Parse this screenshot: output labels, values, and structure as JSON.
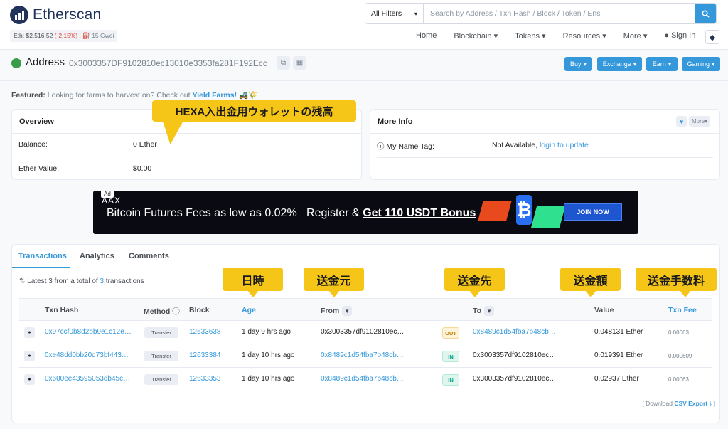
{
  "header": {
    "logo_text": "Etherscan",
    "eth_price_label": "Eth: $2,516.52",
    "eth_change": "(-2.15%)",
    "gas": "15 Gwei",
    "search": {
      "filter": "All Filters",
      "placeholder": "Search by Address / Txn Hash / Block / Token / Ens"
    },
    "nav": [
      "Home",
      "Blockchain",
      "Tokens",
      "Resources",
      "More",
      "Sign In"
    ]
  },
  "address": {
    "label": "Address",
    "hash": "0x3003357DF9102810ec13010e3353fa281F192Ecc",
    "buttons": [
      "Buy",
      "Exchange",
      "Earn",
      "Gaming"
    ]
  },
  "featured": {
    "prefix": "Featured:",
    "text": "Looking for farms to harvest on? Check out",
    "link": "Yield Farms!",
    "emoji": "🚜🌾"
  },
  "overview": {
    "title": "Overview",
    "balance_label": "Balance:",
    "balance_value": "0 Ether",
    "ether_value_label": "Ether Value:",
    "ether_value": "$0.00"
  },
  "more_info": {
    "title": "More Info",
    "more_btn": "More",
    "tag_label": "My Name Tag:",
    "tag_value": "Not Available,",
    "tag_link": "login to update"
  },
  "ad": {
    "tag": "Ad",
    "brand": "AAX",
    "text": "Bitcoin Futures Fees as low as 0.02%",
    "register": "Register &",
    "bonus": "Get 110 USDT Bonus",
    "join": "JOIN NOW"
  },
  "tabs": [
    "Transactions",
    "Analytics",
    "Comments"
  ],
  "summary": {
    "prefix": "Latest 3 from a total of",
    "count": "3",
    "suffix": "transactions"
  },
  "table": {
    "headers": [
      "Txn Hash",
      "Method",
      "Block",
      "Age",
      "From",
      "To",
      "Value",
      "Txn Fee"
    ],
    "rows": [
      {
        "hash": "0x97ccf0b8d2bb9e1c12e…",
        "method": "Transfer",
        "block": "12633638",
        "age": "1 day 9 hrs ago",
        "from": "0x3003357df9102810ec…",
        "dir": "OUT",
        "to": "0x8489c1d54fba7b48cb…",
        "value": "0.048131 Ether",
        "fee": "0.00063"
      },
      {
        "hash": "0xe48dd0bb20d73bf443…",
        "method": "Transfer",
        "block": "12633384",
        "age": "1 day 10 hrs ago",
        "from": "0x8489c1d54fba7b48cb…",
        "dir": "IN",
        "to": "0x3003357df9102810ec…",
        "value": "0.019391 Ether",
        "fee": "0.000609"
      },
      {
        "hash": "0x600ee43595053db45c…",
        "method": "Transfer",
        "block": "12633353",
        "age": "1 day 10 hrs ago",
        "from": "0x8489c1d54fba7b48cb…",
        "dir": "IN",
        "to": "0x3003357df9102810ec…",
        "value": "0.02937 Ether",
        "fee": "0.00063"
      }
    ]
  },
  "csv": {
    "prefix": "[ Download",
    "link": "CSV Export",
    "suffix": "]"
  },
  "annotations": {
    "balance": "HEXA入出金用ウォレットの残高",
    "date": "日時",
    "from": "送金元",
    "to": "送金先",
    "value": "送金額",
    "fee": "送金手数料"
  },
  "colors": {
    "accent": "#3498db",
    "callout": "#f5c518",
    "navy": "#21325b"
  }
}
